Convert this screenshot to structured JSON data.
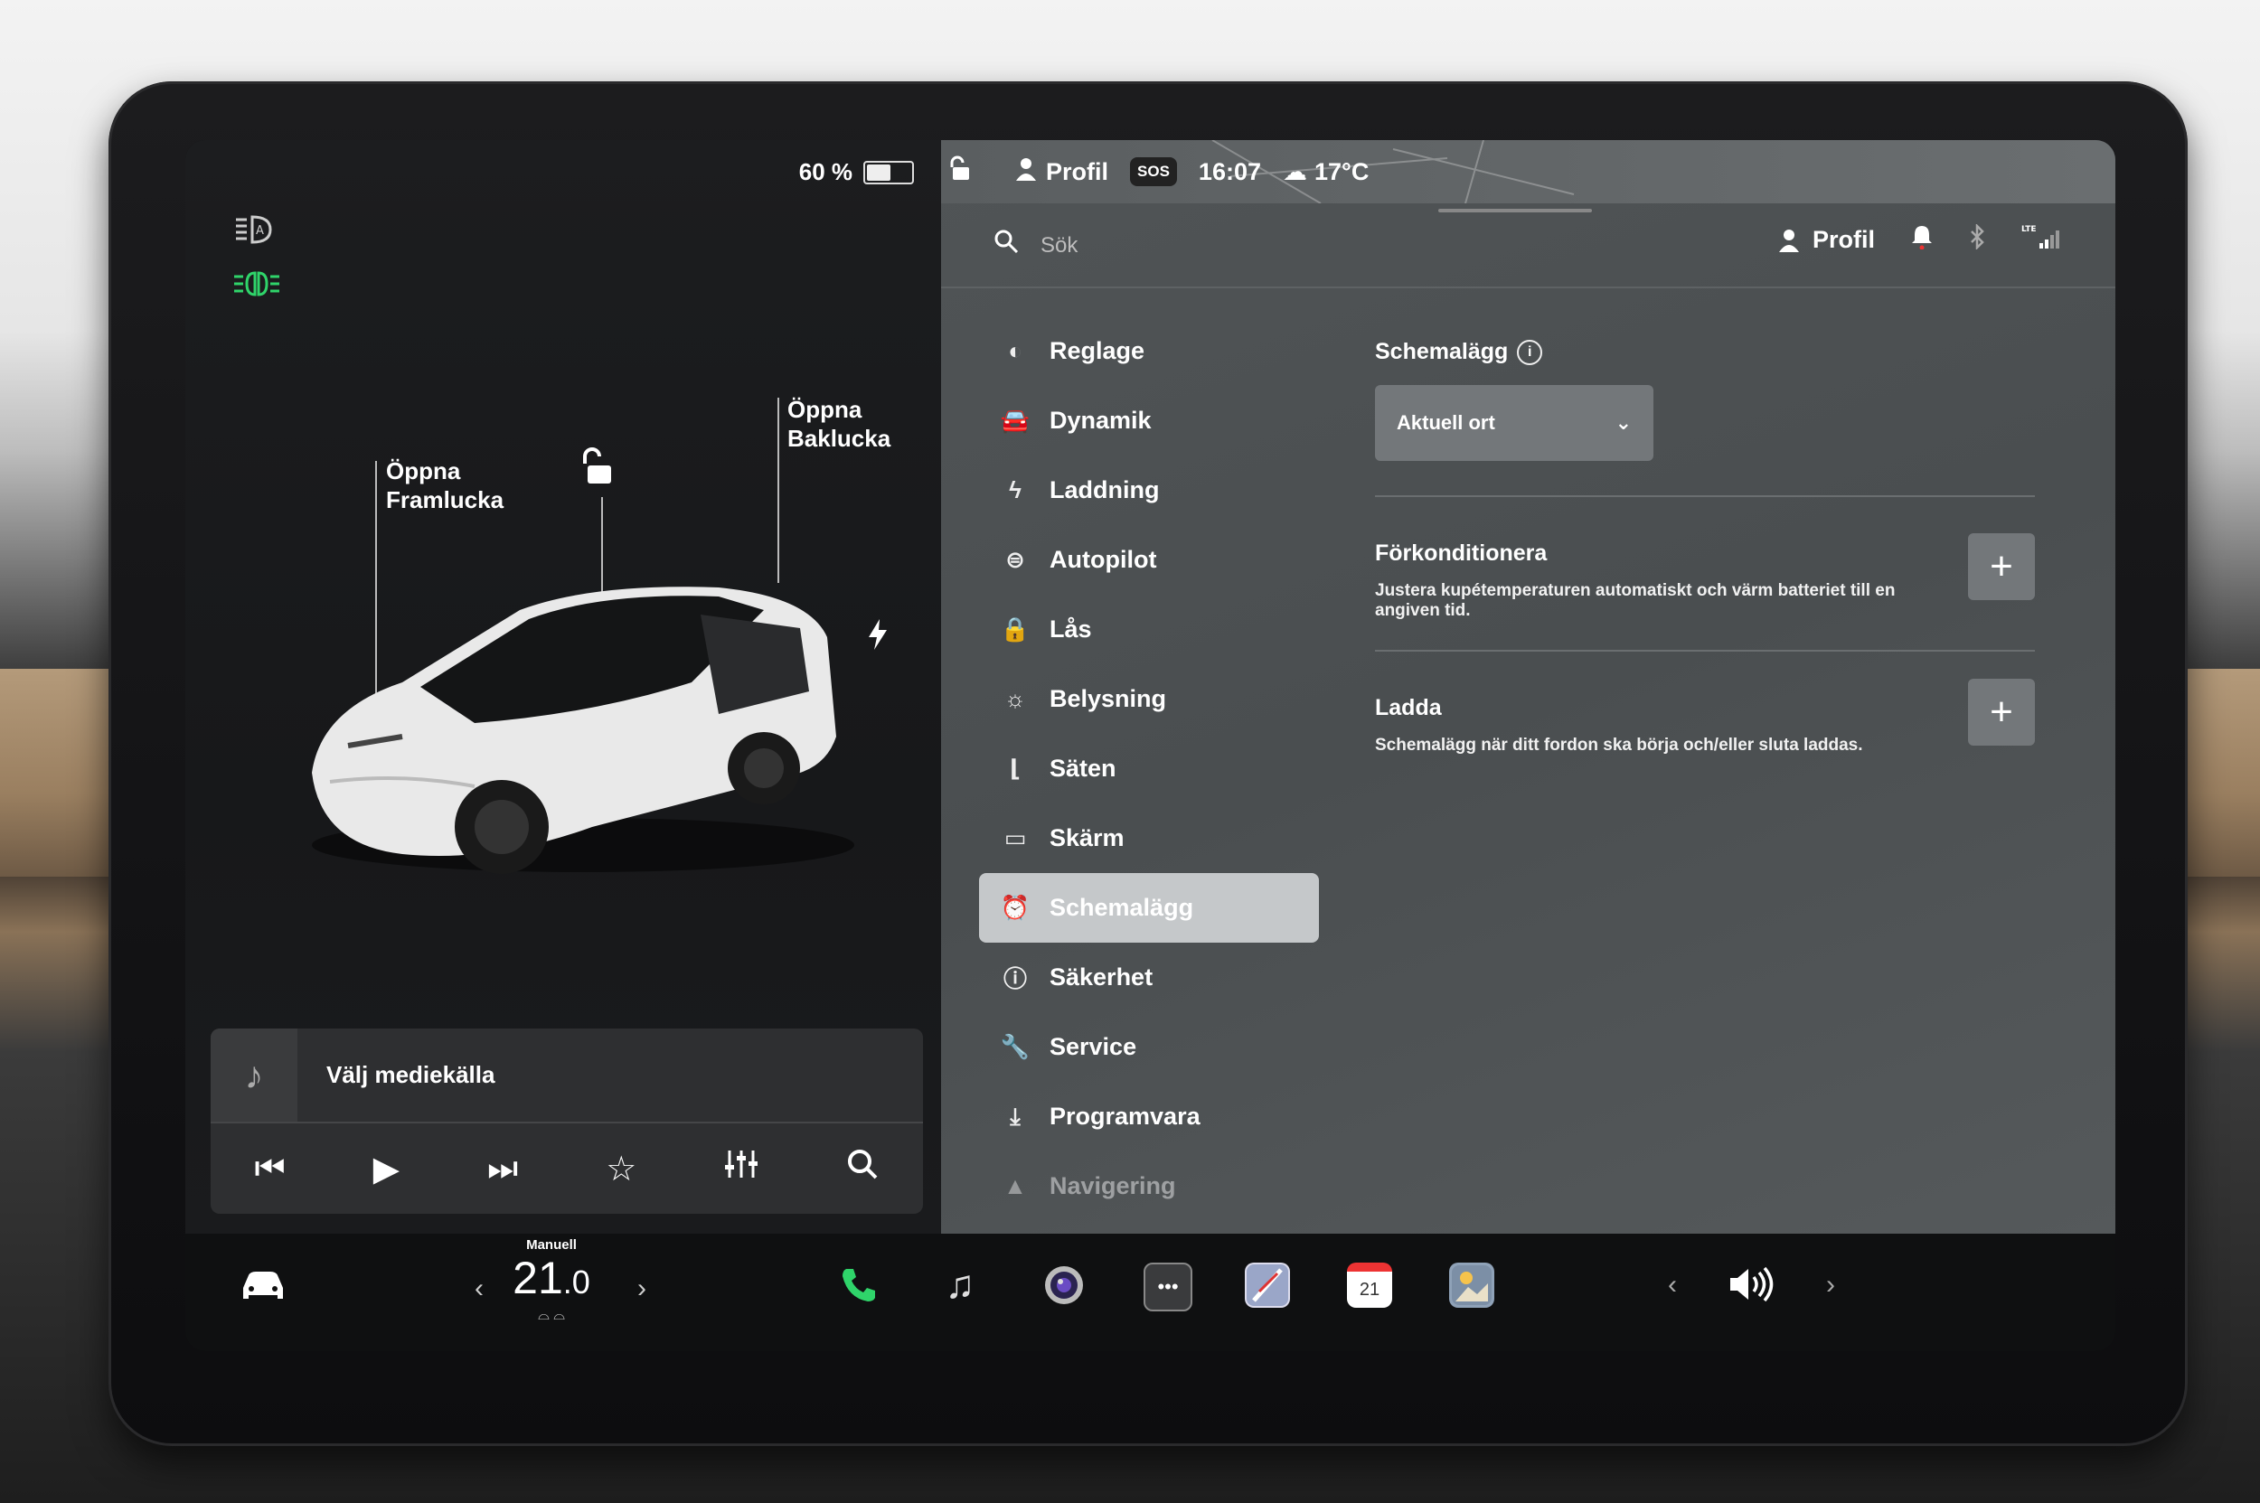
{
  "left_panel": {
    "battery_percent": "60 %",
    "battery_level": 0.6,
    "label_front": [
      "Öppna",
      "Framlucka"
    ],
    "label_trunk": [
      "Öppna",
      "Baklucka"
    ],
    "icon_headlights": "auto-headlights-icon",
    "icon_parking_lights": "parking-lights-icon",
    "lights_color": "#2fd46a"
  },
  "media": {
    "source_label": "Välj mediekälla"
  },
  "status_bar": {
    "profile": "Profil",
    "sos": "SOS",
    "time": "16:07",
    "temperature": "17°C"
  },
  "search": {
    "placeholder": "Sök",
    "profile": "Profil"
  },
  "menu": {
    "items": [
      {
        "label": "Reglage",
        "icon": "toggle-icon"
      },
      {
        "label": "Dynamik",
        "icon": "car-icon"
      },
      {
        "label": "Laddning",
        "icon": "bolt-icon"
      },
      {
        "label": "Autopilot",
        "icon": "steering-wheel-icon"
      },
      {
        "label": "Lås",
        "icon": "lock-icon"
      },
      {
        "label": "Belysning",
        "icon": "sun-icon"
      },
      {
        "label": "Säten",
        "icon": "seat-icon"
      },
      {
        "label": "Skärm",
        "icon": "display-icon"
      },
      {
        "label": "Schemalägg",
        "icon": "alarm-clock-icon"
      },
      {
        "label": "Säkerhet",
        "icon": "warning-icon"
      },
      {
        "label": "Service",
        "icon": "wrench-icon"
      },
      {
        "label": "Programvara",
        "icon": "download-icon"
      },
      {
        "label": "Navigering",
        "icon": "navigation-icon"
      }
    ],
    "active_index": 8
  },
  "content": {
    "schedule_title": "Schemalägg",
    "location_dropdown": "Aktuell ort",
    "precondition_title": "Förkonditionera",
    "precondition_desc": "Justera kupétemperaturen automatiskt och värm batteriet till en angiven tid.",
    "charge_title": "Ladda",
    "charge_desc": "Schemalägg när ditt fordon ska börja och/eller sluta laddas."
  },
  "taskbar": {
    "climate_mode": "Manuell",
    "temp_whole": "21",
    "temp_decimal": ".0",
    "calendar_day": "21"
  }
}
